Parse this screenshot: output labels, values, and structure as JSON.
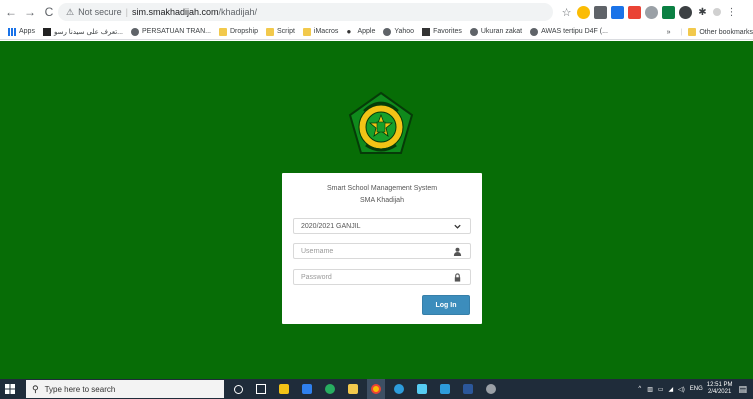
{
  "browser": {
    "security_label": "Not secure",
    "url_host": "sim.smakhadijah.com",
    "url_path": "/khadijah/",
    "bookmarks": [
      {
        "label": "Apps",
        "icon": "apps-icon"
      },
      {
        "label": "تعرف على سيدنا رسو...",
        "icon": "site-icon"
      },
      {
        "label": "PERSATUAN TRAN...",
        "icon": "globe-icon"
      },
      {
        "label": "Dropship",
        "icon": "folder-icon"
      },
      {
        "label": "Script",
        "icon": "folder-icon"
      },
      {
        "label": "iMacros",
        "icon": "folder-icon"
      },
      {
        "label": "Apple",
        "icon": "apple-icon"
      },
      {
        "label": "Yahoo",
        "icon": "globe-icon"
      },
      {
        "label": "Favorites",
        "icon": "square-icon"
      },
      {
        "label": "Ukuran zakat",
        "icon": "globe-icon"
      },
      {
        "label": "AWAS tertipu D4F (...",
        "icon": "globe-icon"
      }
    ],
    "more_bookmarks": "»",
    "other_bookmarks": "Other bookmarks"
  },
  "login": {
    "title": "Smart School Management System",
    "school": "SMA Khadijah",
    "year_selected": "2020/2021 GANJIL",
    "username_placeholder": "Username",
    "password_placeholder": "Password",
    "button_label": "Log In"
  },
  "taskbar": {
    "search_placeholder": "Type here to search",
    "language": "ENG",
    "time": "12:51 PM",
    "date": "2/4/2021"
  },
  "colors": {
    "page_background": "#076d06",
    "button": "#3c8dbc",
    "taskbar": "#1f2c3a"
  }
}
